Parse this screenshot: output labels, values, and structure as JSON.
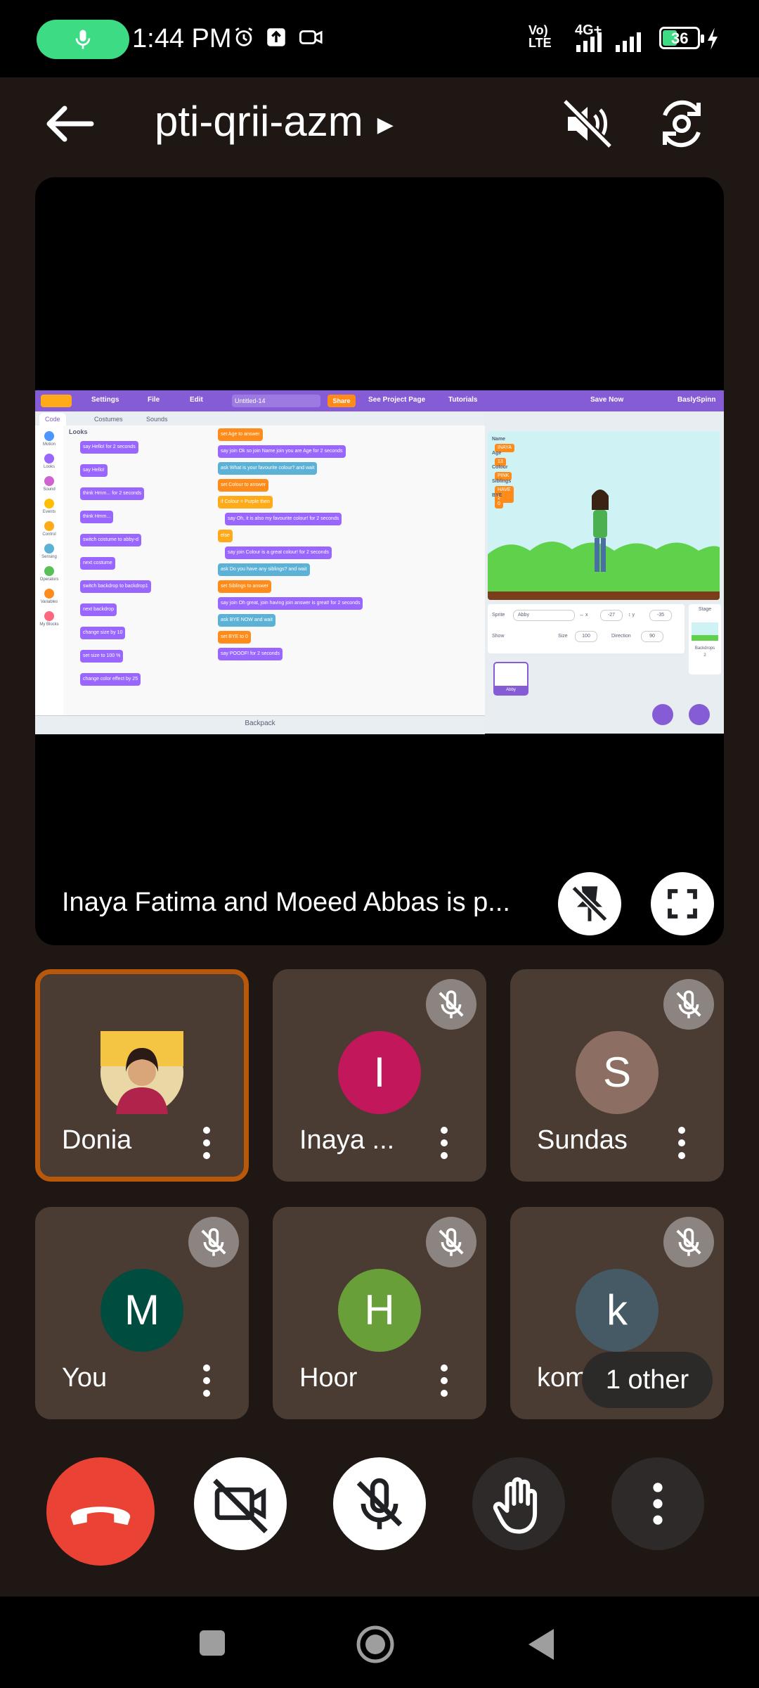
{
  "status_bar": {
    "time": "1:44 PM",
    "network_left": "Vo) LTE",
    "network_right": "4G+",
    "battery": "36",
    "colors": {
      "mic_pill": "#3ddc84"
    }
  },
  "header": {
    "meeting_code": "pti-qrii-azm",
    "icons": [
      "back-arrow-icon",
      "speaker-off-icon",
      "switch-camera-icon"
    ]
  },
  "presentation": {
    "label": "Inaya Fatima and Moeed Abbas is p...",
    "icons": [
      "unpin-icon",
      "fullscreen-icon"
    ],
    "shared_screen": {
      "menu": [
        "Settings",
        "File",
        "Edit"
      ],
      "project_title": "Untitled-14",
      "share": "Share",
      "see_project": "See Project Page",
      "tutorials": "Tutorials",
      "save_now": "Save Now",
      "user": "BaslySpinn",
      "tabs": [
        "Code",
        "Costumes",
        "Sounds"
      ],
      "categories": [
        {
          "name": "Motion",
          "color": "#4c97ff"
        },
        {
          "name": "Looks",
          "color": "#9966ff"
        },
        {
          "name": "Sound",
          "color": "#cf63cf"
        },
        {
          "name": "Events",
          "color": "#ffbf00"
        },
        {
          "name": "Control",
          "color": "#ffab19"
        },
        {
          "name": "Sensing",
          "color": "#5cb1d6"
        },
        {
          "name": "Operators",
          "color": "#59c059"
        },
        {
          "name": "Variables",
          "color": "#ff8c1a"
        },
        {
          "name": "My Blocks",
          "color": "#ff6680"
        }
      ],
      "palette_title": "Looks",
      "palette_blocks": [
        "say Hello! for 2 seconds",
        "say Hello!",
        "think Hmm... for 2 seconds",
        "think Hmm...",
        "switch costume to abby-d",
        "next costume",
        "switch backdrop to backdrop1",
        "next backdrop",
        "change size by 10",
        "set size to 100 %",
        "change color effect by 25"
      ],
      "code_blocks": [
        {
          "text": "set Age to answer",
          "color": "#ff8c1a"
        },
        {
          "text": "say join Ok so join Name join you are Age for 2 seconds",
          "color": "#9966ff"
        },
        {
          "text": "ask What is your favourite colour? and wait",
          "color": "#5cb1d6"
        },
        {
          "text": "set Colour to answer",
          "color": "#ff8c1a"
        },
        {
          "text": "if Colour = Purple then",
          "color": "#ffab19"
        },
        {
          "text": "say Oh, it is also my favourite colour! for 2 seconds",
          "color": "#9966ff"
        },
        {
          "text": "else",
          "color": "#ffab19"
        },
        {
          "text": "say join Colour is a great colour! for 2 seconds",
          "color": "#9966ff"
        },
        {
          "text": "ask Do you have any siblings? and wait",
          "color": "#5cb1d6"
        },
        {
          "text": "set Siblings to answer",
          "color": "#ff8c1a"
        },
        {
          "text": "say join Oh great, join having join answer is great! for 2 seconds",
          "color": "#9966ff"
        },
        {
          "text": "ask BYE NOW and wait",
          "color": "#5cb1d6"
        },
        {
          "text": "set BYE to 0",
          "color": "#ff8c1a"
        },
        {
          "text": "say POOOF! for 2 seconds",
          "color": "#9966ff"
        }
      ],
      "variables": [
        {
          "name": "Name",
          "value": "INAYA"
        },
        {
          "name": "Age",
          "value": "13"
        },
        {
          "name": "Colour",
          "value": "PINK"
        },
        {
          "name": "Siblings",
          "value": "HAVE 2"
        },
        {
          "name": "BYE",
          "value": "0"
        }
      ],
      "sprite_label": "Sprite",
      "sprite_name": "Abby",
      "x": "-27",
      "y": "-35",
      "show": "Show",
      "size_label": "Size",
      "size": "100",
      "direction_label": "Direction",
      "direction": "90",
      "stage_label": "Stage",
      "backdrops_label": "Backdrops",
      "backdrops_count": "2",
      "sprite_thumb": "Abby",
      "backpack": "Backpack"
    }
  },
  "participants": [
    {
      "name": "Donia",
      "initial": "",
      "color": "#e0a96d",
      "active": true,
      "muted": false
    },
    {
      "name": "Inaya ...",
      "initial": "I",
      "color": "#c2185b",
      "active": false,
      "muted": true
    },
    {
      "name": "Sundas",
      "initial": "S",
      "color": "#8d6e63",
      "active": false,
      "muted": true
    },
    {
      "name": "You",
      "initial": "M",
      "color": "#004d40",
      "active": false,
      "muted": true
    },
    {
      "name": "Hoor",
      "initial": "H",
      "color": "#689f38",
      "active": false,
      "muted": true
    },
    {
      "name": "koma",
      "initial": "k",
      "color": "#455a64",
      "active": false,
      "muted": true
    }
  ],
  "other_chip": "1 other",
  "controls": {
    "icons": [
      "end-call-icon",
      "camera-off-icon",
      "mic-off-icon",
      "raise-hand-icon",
      "more-options-icon"
    ],
    "colors": {
      "end_call": "#ea4335",
      "white_button": "#ffffff",
      "dark_button": "#2e2a29"
    }
  }
}
